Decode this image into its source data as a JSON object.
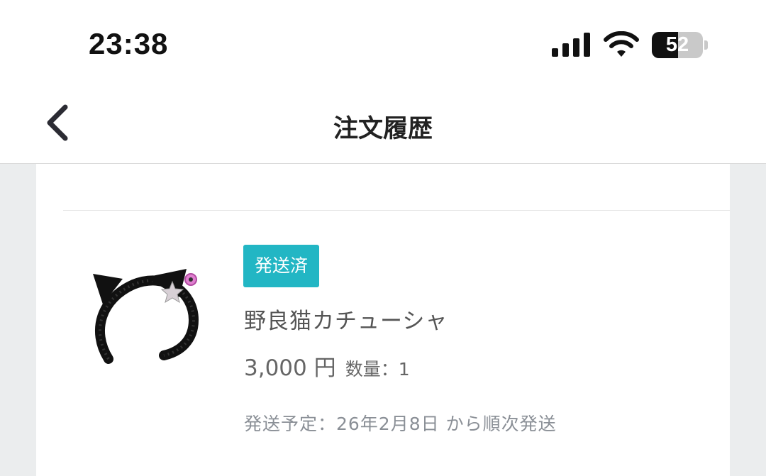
{
  "status_bar": {
    "time": "23:38",
    "battery_percent": "52",
    "battery_level": 0.52
  },
  "nav": {
    "title": "注文履歴",
    "back_icon": "chevron-left-icon"
  },
  "order": {
    "status_badge": "発送済",
    "badge_color": "#22b6c4",
    "product_name": "野良猫カチューシャ",
    "price": "3,000 円",
    "quantity": "数量：1",
    "shipping_note": "発送予定：26年2月8日 から順次発送",
    "thumbnail_icon": "cat-ear-headband-image"
  }
}
